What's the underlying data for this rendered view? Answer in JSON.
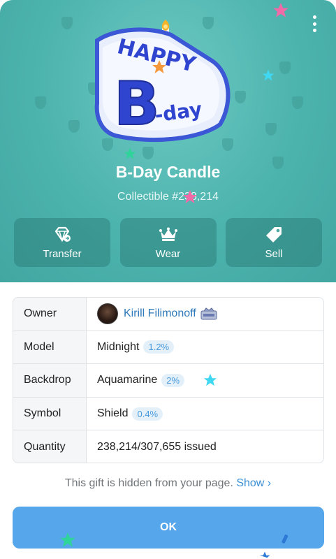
{
  "gift": {
    "title": "B-Day Candle",
    "subtitle": "Collectible #238,214",
    "sticker_text_top": "HAPPY",
    "sticker_text_big": "B",
    "sticker_text_bottom": "-day"
  },
  "actions": [
    {
      "label": "Transfer",
      "icon": "gift-transfer-icon"
    },
    {
      "label": "Wear",
      "icon": "crown-icon"
    },
    {
      "label": "Sell",
      "icon": "tag-icon"
    }
  ],
  "info": {
    "owner_label": "Owner",
    "owner_name": "Kirill Filimonoff",
    "model_label": "Model",
    "model_value": "Midnight",
    "model_pct": "1.2%",
    "backdrop_label": "Backdrop",
    "backdrop_value": "Aquamarine",
    "backdrop_pct": "2%",
    "symbol_label": "Symbol",
    "symbol_value": "Shield",
    "symbol_pct": "0.4%",
    "quantity_label": "Quantity",
    "quantity_value": "238,214/307,655 issued"
  },
  "note": {
    "text": "This gift is hidden from your page. ",
    "link": "Show ›"
  },
  "ok_button": "OK",
  "colors": {
    "backdrop": "#4db3ad",
    "button": "#55a6ea",
    "link": "#3a8fd6"
  }
}
